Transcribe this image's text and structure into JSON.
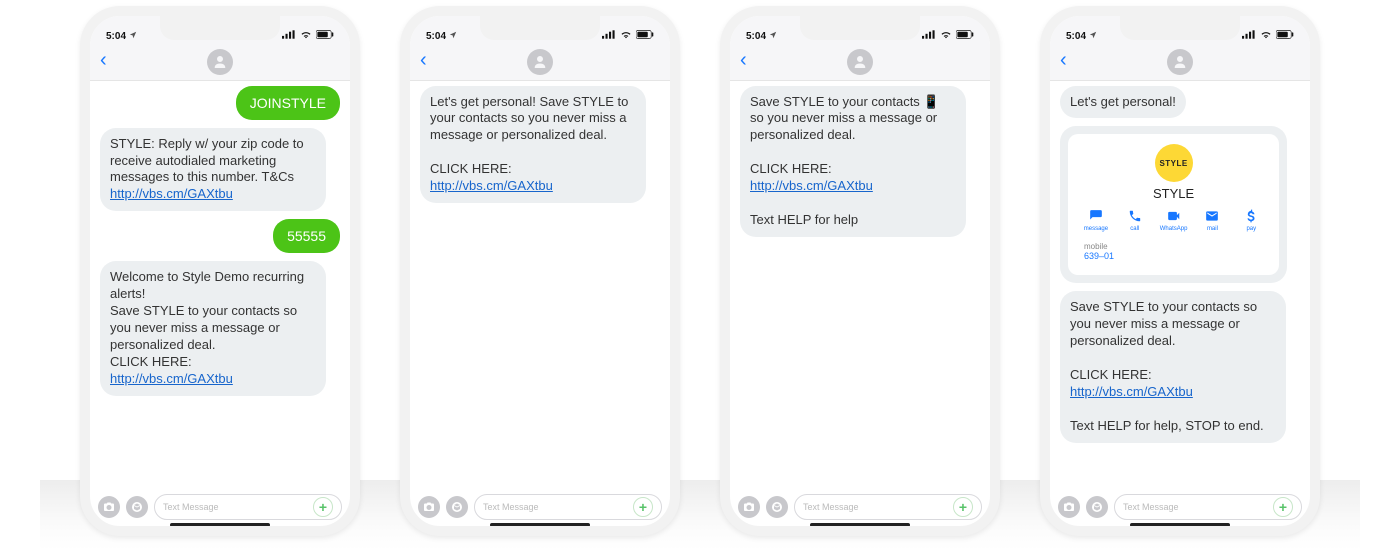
{
  "time": "5:04",
  "input_placeholder": "Text Message",
  "card": {
    "brand": "STYLE",
    "logo_text": "STYLE",
    "actions": [
      "message",
      "call",
      "WhatsApp",
      "mail",
      "pay"
    ],
    "mobile_label": "mobile",
    "mobile_num": "639–01"
  },
  "phones": [
    {
      "msgs": [
        {
          "type": "tx",
          "text": "JOINSTYLE"
        },
        {
          "type": "rx",
          "text": "STYLE: Reply w/ your zip code to receive autodialed marketing messages to this number. T&Cs",
          "link": "http://vbs.cm/GAXtbu"
        },
        {
          "type": "tx",
          "text": "55555"
        },
        {
          "type": "rx",
          "text": "Welcome to Style Demo recurring alerts!\nSave STYLE to your contacts so you never miss a message or personalized deal.\nCLICK HERE:",
          "link": "http://vbs.cm/GAXtbu"
        }
      ]
    },
    {
      "msgs": [
        {
          "type": "rx",
          "text": "Let's get personal! Save STYLE to your contacts so you never miss a message or personalized deal.\n\nCLICK HERE:",
          "link": "http://vbs.cm/GAXtbu"
        }
      ]
    },
    {
      "msgs": [
        {
          "type": "rx",
          "text": "Save STYLE to your contacts 📱 so you never miss a message or personalized deal.\n\nCLICK HERE:",
          "link": "http://vbs.cm/GAXtbu",
          "tail": "\n\nText HELP for help"
        }
      ]
    },
    {
      "msgs": [
        {
          "type": "rx",
          "text": "Let's get personal!"
        },
        {
          "type": "card"
        },
        {
          "type": "rx",
          "text": "Save STYLE to your contacts so you never miss a message or personalized deal.\n\nCLICK HERE:",
          "link": "http://vbs.cm/GAXtbu",
          "tail": "\n\nText HELP for help, STOP to end."
        }
      ]
    }
  ]
}
